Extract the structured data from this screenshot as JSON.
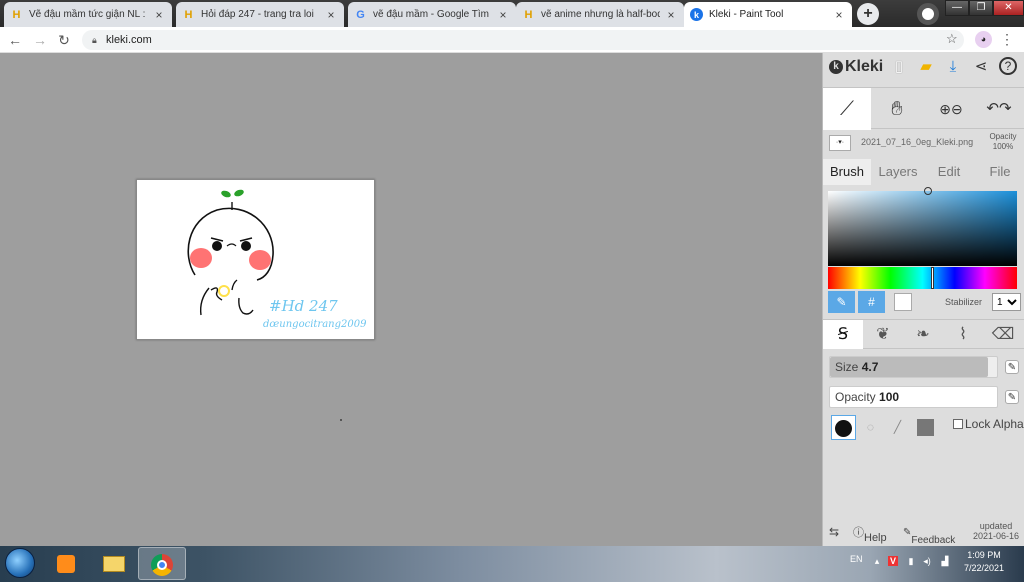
{
  "browser": {
    "tabs": [
      {
        "title": "Vẽ đậu mầm tức giận NL : Trí t",
        "favicon": "hoidap-icon"
      },
      {
        "title": "Hỏi đáp 247 - trang tra loi",
        "favicon": "hoidap-icon"
      },
      {
        "title": "vẽ đậu mầm - Google Tìm kiế",
        "favicon": "google-icon"
      },
      {
        "title": "vẽ anime nhưng là half-body t",
        "favicon": "hoidap-icon"
      },
      {
        "title": "Kleki - Paint Tool",
        "favicon": "kleki-icon",
        "active": true
      }
    ],
    "tab_close": "×",
    "new_tab": "+",
    "window_controls": {
      "minimize": "—",
      "maximize": "❐",
      "close": "✕"
    },
    "url": "kleki.com",
    "nav": {
      "back": "←",
      "forward": "→",
      "reload": "↻"
    },
    "menu": "⋮",
    "star": "☆"
  },
  "kleki": {
    "logo": "Kleki",
    "file_name": "2021_07_16_0eg_Kleki.png",
    "opacity_label": "Opacity",
    "opacity_value": "100%",
    "tabs": [
      "Brush",
      "Layers",
      "Edit",
      "File"
    ],
    "active_tab": "Brush",
    "stabilizer_label": "Stabilizer",
    "stabilizer_value": "1",
    "hash": "#",
    "size_label": "Size",
    "size_value": "4.7",
    "opacity_slider_label": "Opacity",
    "opacity_slider_value": "100",
    "lock_alpha": "Lock Alpha",
    "help": "Help",
    "feedback": "Feedback",
    "updated_label": "updated",
    "updated_date": "2021-06-16",
    "color_picker_hue": "#1b8fd9"
  },
  "drawing": {
    "text1": "#Hd 247",
    "text2": "dœungocitrang2009"
  },
  "taskbar": {
    "lang": "EN",
    "time": "1:09 PM",
    "date": "7/22/2021"
  }
}
